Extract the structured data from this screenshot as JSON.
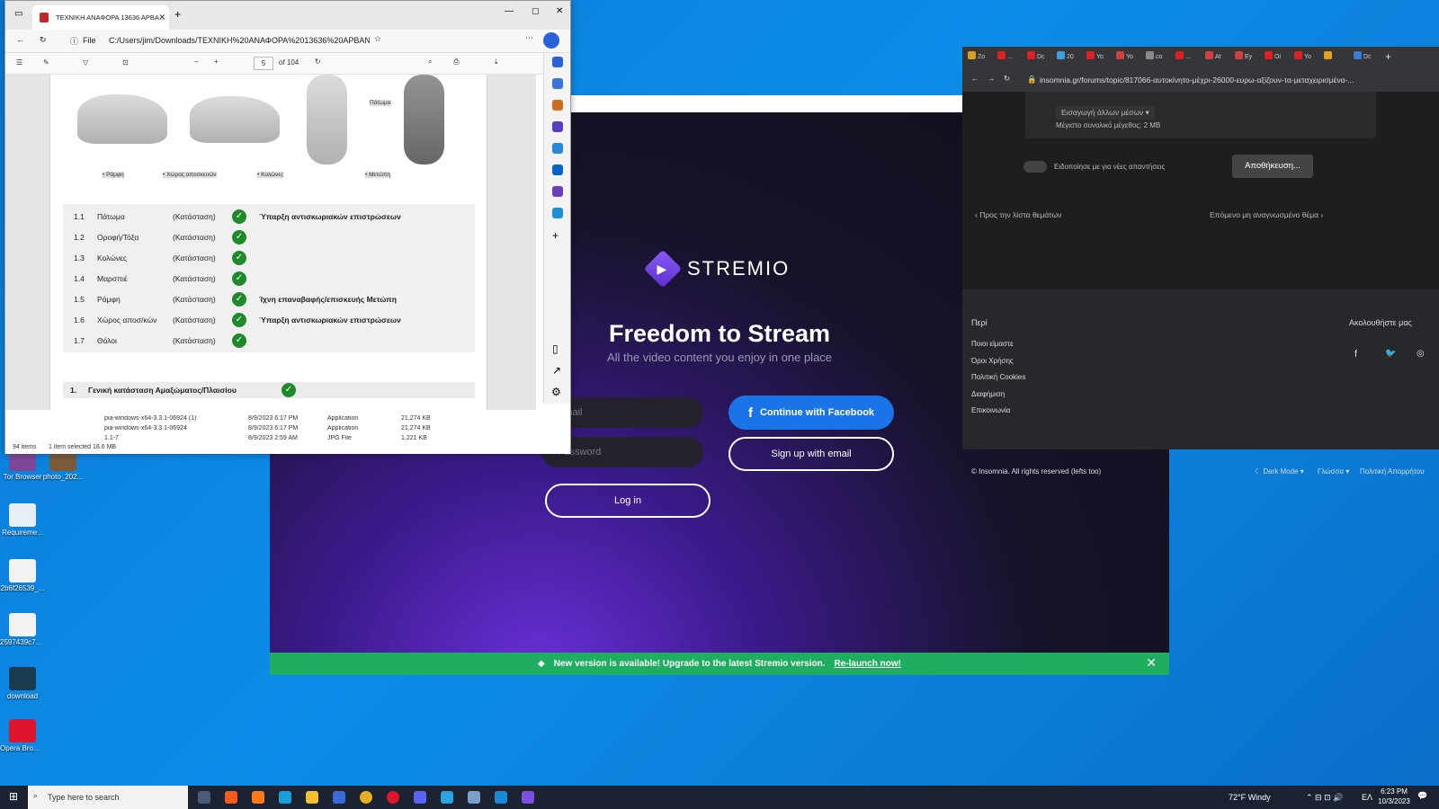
{
  "desktop_icons": [
    {
      "label": "Tor Browser",
      "icon": "tor-browser-icon",
      "color": "#7d4698"
    },
    {
      "label": "photo_202...",
      "icon": "photo-icon",
      "color": "#7a5a3a"
    },
    {
      "label": "Requireme...",
      "icon": "document-icon",
      "color": "#e8eef5"
    },
    {
      "label": "2b6f26539_...",
      "icon": "document-icon",
      "color": "#f2f2f2"
    },
    {
      "label": "2597439c7_...",
      "icon": "document-icon",
      "color": "#f2f2f2"
    },
    {
      "label": "download",
      "icon": "image-icon",
      "color": "#1a3a50"
    },
    {
      "label": "Opera Browser",
      "icon": "opera-icon",
      "color": "#e0142c"
    }
  ],
  "stremio": {
    "brand": "STREMIO",
    "headline": "Freedom to Stream",
    "subheadline": "All the video content you enjoy in one place",
    "email_placeholder": "Email",
    "password_placeholder": "Password",
    "facebook_label": "Continue with Facebook",
    "signup_label": "Sign up with email",
    "login_label": "Log in",
    "banner_text": "New version is available! Upgrade to the latest Stremio version.",
    "banner_link": "Re-launch now!",
    "colors": {
      "facebook": "#1a74e8",
      "banner": "#1fad5f",
      "brand": "#7b4fe0"
    }
  },
  "pdf": {
    "tab_title": "ΤΕΧΝΙΚΗ ΑΝΑΦΟΡΑ 13636 ΑΡΒΑ...",
    "address_prefix": "File",
    "address": "C:/Users/jim/Downloads/ΤΕΧΝΙΚΗ%20ΑΝΑΦΟΡΑ%2013636%20ΑΡΒΑΝΙ...",
    "page_current": "5",
    "page_total": "of 104",
    "captions": [
      "• Ράμφη",
      "• Χώρος αποσκευών",
      "• Κολώνες",
      "• Μετώπη",
      "Πάτωμα"
    ],
    "rows": [
      {
        "num": "1.1",
        "name": "Πάτωμα",
        "state": "(Κατάσταση)",
        "note": "Ύπαρξη αντισκωριακών επιστρώσεων"
      },
      {
        "num": "1.2",
        "name": "Οροφή/Τόξα",
        "state": "(Κατάσταση)",
        "note": ""
      },
      {
        "num": "1.3",
        "name": "Κολώνες",
        "state": "(Κατάσταση)",
        "note": ""
      },
      {
        "num": "1.4",
        "name": "Μαρσπιέ",
        "state": "(Κατάσταση)",
        "note": ""
      },
      {
        "num": "1.5",
        "name": "Ράμφη",
        "state": "(Κατάσταση)",
        "note": "Ίχνη επαναβαφής/επισκευής Μετώπη"
      },
      {
        "num": "1.6",
        "name": "Χώρος αποσ/κών",
        "state": "(Κατάσταση)",
        "note": "Ύπαρξη αντισκωριακών επιστρώσεων"
      },
      {
        "num": "1.7",
        "name": "Θόλοι",
        "state": "(Κατάσταση)",
        "note": ""
      }
    ],
    "summary_num": "1.",
    "summary_title": "Γενική κατάσταση Αμαξώματος/Πλαισίου"
  },
  "explorer": {
    "files": [
      {
        "name": "pia-windows-x64-3.3.1-06924 (1)",
        "date": "8/9/2023 6:17 PM",
        "type": "Application",
        "size": "21,274 KB"
      },
      {
        "name": "pia-windows-x64-3.3.1-06924",
        "date": "8/9/2023 6:17 PM",
        "type": "Application",
        "size": "21,274 KB"
      },
      {
        "name": "1.1-7",
        "date": "8/9/2023 2:59 AM",
        "type": "JPG File",
        "size": "1,221 KB"
      }
    ],
    "status_items": "94 items",
    "status_selected": "1 item selected  18.6 MB"
  },
  "chrome": {
    "tabs": [
      "Zo",
      "...",
      "Dc",
      "20",
      "Yo",
      "Yo",
      "co",
      "...",
      "At",
      "Ey",
      "Oi",
      "Yo",
      "",
      "Dc"
    ],
    "url": "insomnia.gr/forums/topic/817066-αυτοκίνητο-μέχρι-26000-ευρω-αξίζουν-τα-μεταχειρισμένα-...",
    "insert_media": "Εισαγωγή άλλων μέσων ▾",
    "max_size": "Μέγιστο συνολικό μέγεθος: 2 MB",
    "notify_toggle": "Ειδοποίησε με για νέες απαντήσεις",
    "save_button": "Αποθήκευση...",
    "back_to_list": "Προς την λίστα θεμάτων",
    "next_unread": "Επόμενο μη αναγνωσμένο θέμα",
    "about_heading": "Περί",
    "follow_heading": "Ακολουθήστε μας",
    "footer_links": [
      "Ποιοι είμαστε",
      "Όροι Χρήσης",
      "Πολιτική Cookies",
      "Διαφήμιση",
      "Επικοινωνία"
    ],
    "copyright": "© Insomnia. All rights reserved (lefts too)",
    "dark_mode": "☾ Dark Mode ▾",
    "language": "Γλώσσα ▾",
    "privacy": "Πολιτική Απορρήτου"
  },
  "taskbar": {
    "search_placeholder": "Type here to search",
    "weather": "72°F  Windy",
    "lang": "ΕΛ",
    "time": "6:23 PM",
    "date": "10/3/2023"
  }
}
